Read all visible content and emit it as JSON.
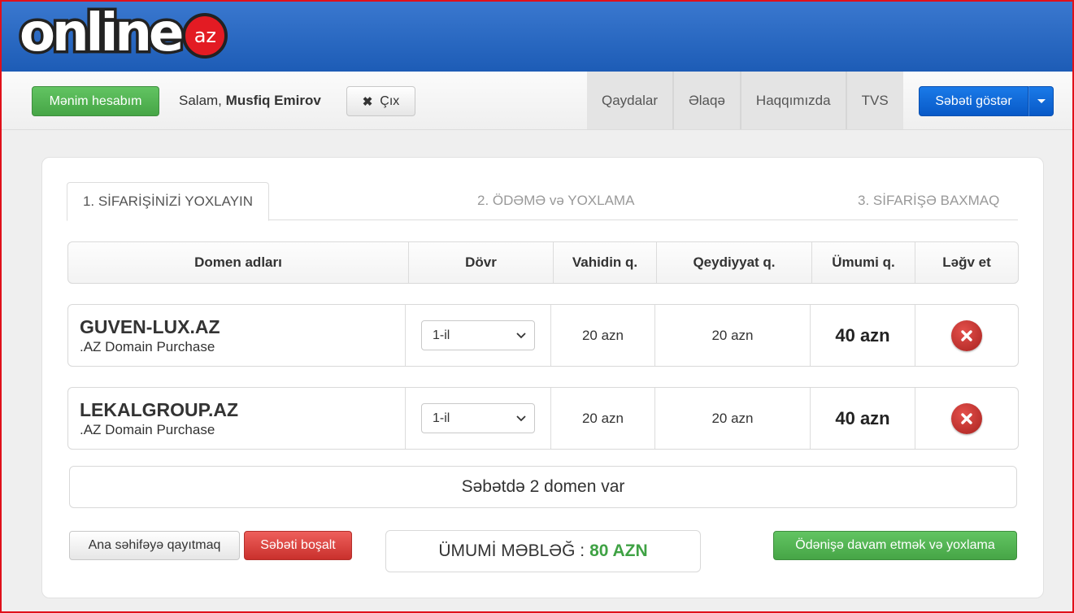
{
  "logo": {
    "text": "online",
    "badge": "az"
  },
  "navbar": {
    "account_button": "Mənim hesabım",
    "greeting_prefix": "Salam,",
    "user_name": "Musfiq Emirov",
    "logout_button": "Çıx",
    "links": [
      "Qaydalar",
      "Əlaqə",
      "Haqqımızda",
      "TVS"
    ],
    "cart_button": "Səbəti göstər"
  },
  "tabs": [
    "1. SİFARİŞİNİZİ YOXLAYIN",
    "2. ÖDƏMƏ və YOXLAMA",
    "3. SİFARİŞƏ BAXMAQ"
  ],
  "table": {
    "headers": [
      "Domen adları",
      "Dövr",
      "Vahidin q.",
      "Qeydiyyat q.",
      "Ümumi q.",
      "Ləğv et"
    ],
    "rows": [
      {
        "domain": "GUVEN-LUX.AZ",
        "description": ".AZ Domain Purchase",
        "period": "1-il",
        "unit_price": "20 azn",
        "registration_price": "20 azn",
        "total": "40 azn"
      },
      {
        "domain": "LEKALGROUP.AZ",
        "description": ".AZ Domain Purchase",
        "period": "1-il",
        "unit_price": "20 azn",
        "registration_price": "20 azn",
        "total": "40 azn"
      }
    ]
  },
  "summary": "Səbətdə 2 domen var",
  "footer": {
    "home_button": "Ana səhifəyə qayıtmaq",
    "empty_cart_button": "Səbəti boşalt",
    "grand_total_label": "ÜMUMİ MƏBLƏĞ :",
    "grand_total_value": "80 AZN",
    "checkout_button": "Ödənişə davam etmək və yoxlama"
  },
  "colors": {
    "header_blue": "#2a6cc6",
    "green": "#46a546",
    "red": "#c9302c",
    "blue_button": "#0859c7",
    "total_green": "#3fa244",
    "frame_red": "#e0101a"
  },
  "icons": [
    "close-x-icon",
    "caret-down-icon",
    "cancel-circle-icon",
    "chevron-down-icon"
  ]
}
